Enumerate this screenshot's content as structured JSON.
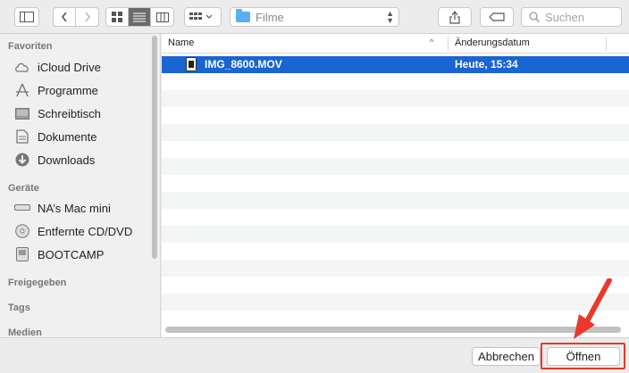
{
  "toolbar": {
    "path_label": "Filme",
    "search_placeholder": "Suchen"
  },
  "sidebar": {
    "sections": [
      {
        "label": "Favoriten"
      },
      {
        "label": "Geräte"
      },
      {
        "label": "Freigegeben"
      },
      {
        "label": "Tags"
      },
      {
        "label": "Medien"
      }
    ],
    "favorites": [
      {
        "label": "iCloud Drive",
        "icon": "cloud-icon"
      },
      {
        "label": "Programme",
        "icon": "apps-icon"
      },
      {
        "label": "Schreibtisch",
        "icon": "desktop-icon"
      },
      {
        "label": "Dokumente",
        "icon": "document-icon"
      },
      {
        "label": "Downloads",
        "icon": "download-icon"
      }
    ],
    "devices": [
      {
        "label": "NA’s Mac mini",
        "icon": "mac-mini-icon"
      },
      {
        "label": "Entfernte CD/DVD",
        "icon": "disc-icon"
      },
      {
        "label": "BOOTCAMP",
        "icon": "drive-icon"
      }
    ]
  },
  "filelist": {
    "columns": {
      "name": "Name",
      "date": "Änderungsdatum"
    },
    "files": [
      {
        "name": "IMG_8600.MOV",
        "date": "Heute, 15:34",
        "selected": true
      }
    ]
  },
  "buttons": {
    "cancel": "Abbrechen",
    "open": "Öffnen"
  },
  "colors": {
    "selection": "#1a64d3",
    "highlight": "#e8392a"
  }
}
